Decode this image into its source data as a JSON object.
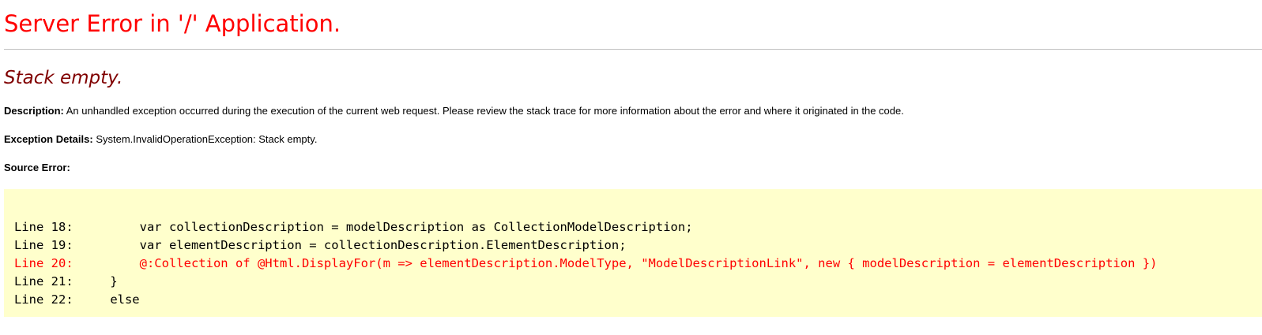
{
  "header": {
    "title": "Server Error in '/' Application."
  },
  "error": {
    "message": "Stack empty."
  },
  "description": {
    "label": "Description:",
    "text": " An unhandled exception occurred during the execution of the current web request. Please review the stack trace for more information about the error and where it originated in the code."
  },
  "exception_details": {
    "label": "Exception Details:",
    "text": " System.InvalidOperationException: Stack empty."
  },
  "source_error": {
    "label": "Source Error:",
    "lines": [
      {
        "text": "Line 18:         var collectionDescription = modelDescription as CollectionModelDescription;",
        "highlighted": false
      },
      {
        "text": "Line 19:         var elementDescription = collectionDescription.ElementDescription;",
        "highlighted": false
      },
      {
        "text": "Line 20:         @:Collection of @Html.DisplayFor(m => elementDescription.ModelType, \"ModelDescriptionLink\", new { modelDescription = elementDescription })",
        "highlighted": true
      },
      {
        "text": "Line 21:     }",
        "highlighted": false
      },
      {
        "text": "Line 22:     else",
        "highlighted": false
      }
    ]
  },
  "colors": {
    "title": "#ff0000",
    "message": "#800000",
    "code_background": "#ffffcc",
    "error_line": "#ff0000"
  }
}
